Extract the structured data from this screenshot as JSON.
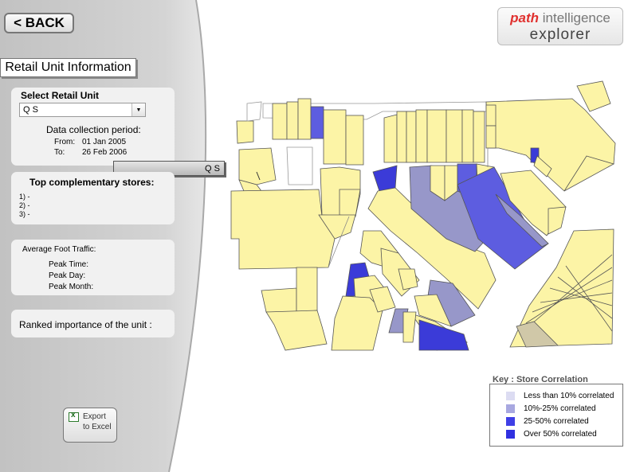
{
  "nav": {
    "back_label": "< BACK"
  },
  "logo": {
    "brand_bold": "path",
    "brand_rest": " intelligence",
    "product": "explorer"
  },
  "panel": {
    "title": "Retail Unit Information",
    "select_label": "Select Retail Unit",
    "selected_unit": "Q S",
    "collection_heading": "Data collection period:",
    "from_label": "From:",
    "from_value": "01 Jan 2005",
    "to_label": "To:",
    "to_value": "26 Feb 2006",
    "complementary_heading": "Top complementary stores:",
    "complementary": [
      {
        "rank": "1)",
        "value": "-"
      },
      {
        "rank": "2)",
        "value": "-"
      },
      {
        "rank": "3)",
        "value": "-"
      }
    ],
    "traffic_heading": "Average Foot Traffic:",
    "peak_time_label": "Peak Time:",
    "peak_day_label": "Peak Day:",
    "peak_month_label": "Peak Month:",
    "ranked_label": "Ranked importance of the unit :"
  },
  "map": {
    "tooltip": "Q S"
  },
  "export": {
    "line1": "Export",
    "line2": "to Excel",
    "icon": "excel-icon"
  },
  "key": {
    "title": "Key : Store Correlation",
    "items": [
      {
        "label": "Less than 10% correlated",
        "color": "#dcdcf2"
      },
      {
        "label": "10%-25% correlated",
        "color": "#a8a8e0"
      },
      {
        "label": "25-50% correlated",
        "color": "#3f3fe6"
      },
      {
        "label": "Over 50% correlated",
        "color": "#3030e0"
      }
    ]
  },
  "colors": {
    "store": "#fcf4a6",
    "corr_low": "#9797c9",
    "corr_mid": "#5d5de0",
    "corr_high": "#3b3bd8",
    "panel_bg": "#cbcbcb"
  }
}
